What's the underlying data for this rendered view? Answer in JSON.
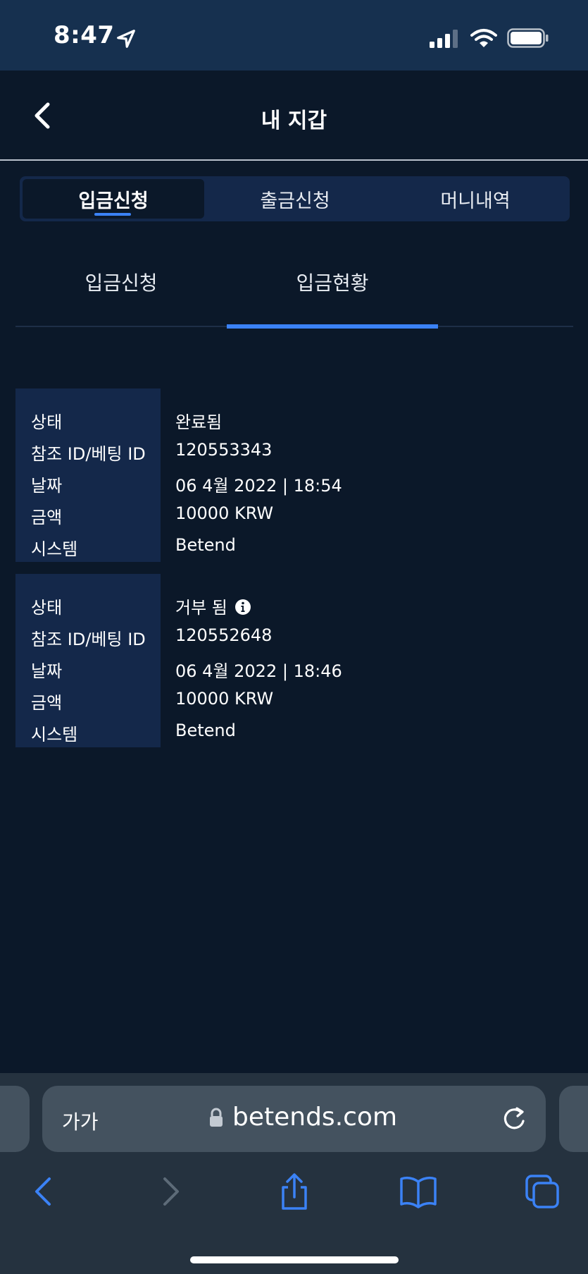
{
  "status_bar": {
    "time": "8:47"
  },
  "header": {
    "title": "내 지갑"
  },
  "main_tabs": [
    {
      "label": "입금신청",
      "active": true
    },
    {
      "label": "출금신청",
      "active": false
    },
    {
      "label": "머니내역",
      "active": false
    }
  ],
  "sub_tabs": [
    {
      "label": "입금신청",
      "active": false
    },
    {
      "label": "입금현황",
      "active": true
    }
  ],
  "labels": {
    "status": "상태",
    "ref_id": "참조 ID/베팅 ID",
    "date": "날짜",
    "amount": "금액",
    "system": "시스템"
  },
  "records": [
    {
      "status": "완료됨",
      "ref_id": "120553343",
      "date": "06 4월 2022 | 18:54",
      "amount": "10000 KRW",
      "system": "Betend"
    },
    {
      "status": "거부 됨",
      "ref_id": "120552648",
      "date": "06 4월 2022 | 18:46",
      "amount": "10000 KRW",
      "system": "Betend"
    }
  ],
  "browser": {
    "reader_label": "가가",
    "url": "betends.com"
  },
  "colors": {
    "background": "#0b1829",
    "accent": "#3b82f6",
    "panel": "#14284a"
  }
}
